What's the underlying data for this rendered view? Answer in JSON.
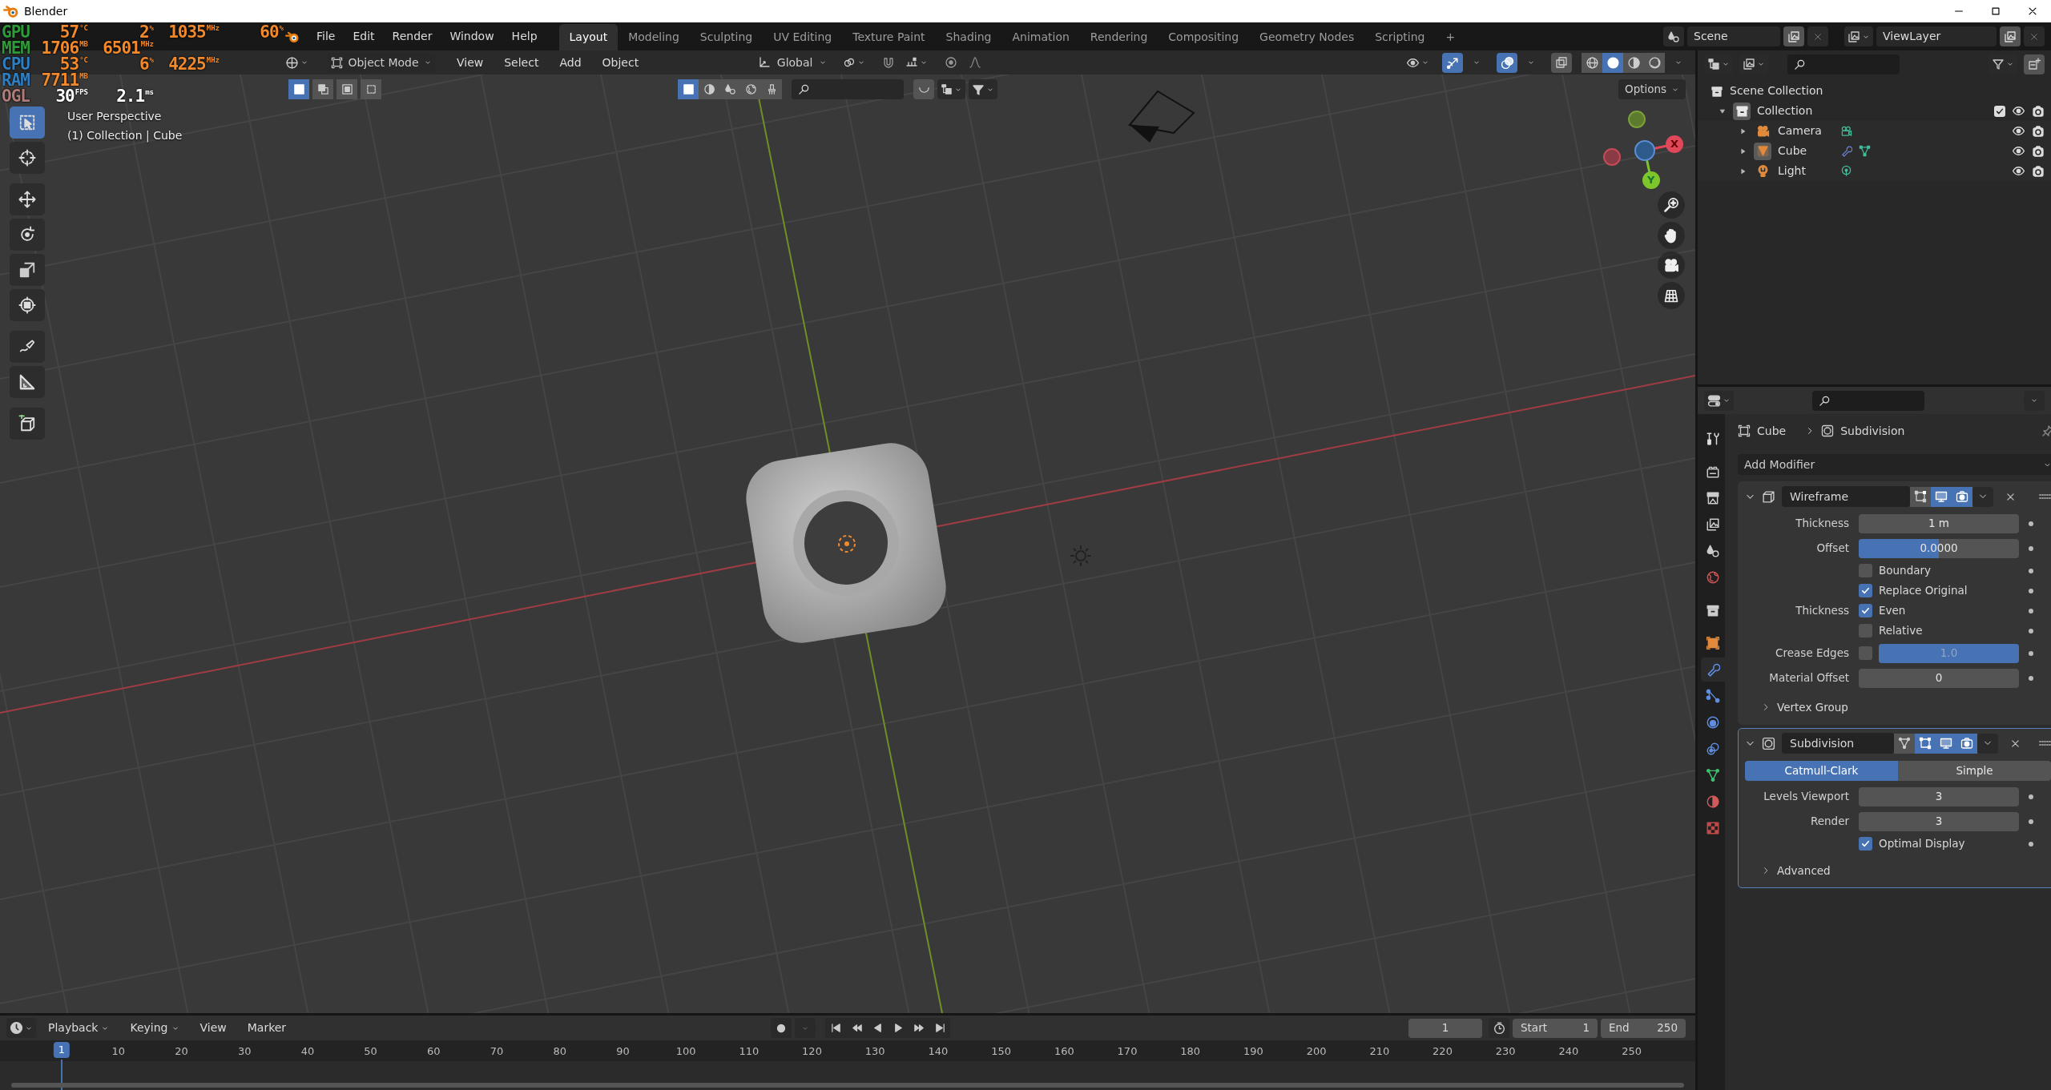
{
  "window": {
    "title": "Blender"
  },
  "menus": [
    "File",
    "Edit",
    "Render",
    "Window",
    "Help"
  ],
  "workspaces": [
    {
      "label": "Layout",
      "selected": true
    },
    {
      "label": "Modeling",
      "selected": false
    },
    {
      "label": "Sculpting",
      "selected": false
    },
    {
      "label": "UV Editing",
      "selected": false
    },
    {
      "label": "Texture Paint",
      "selected": false
    },
    {
      "label": "Shading",
      "selected": false
    },
    {
      "label": "Animation",
      "selected": false
    },
    {
      "label": "Rendering",
      "selected": false
    },
    {
      "label": "Compositing",
      "selected": false
    },
    {
      "label": "Geometry Nodes",
      "selected": false
    },
    {
      "label": "Scripting",
      "selected": false
    }
  ],
  "add_workspace": "+",
  "scene": "Scene",
  "view_layer": "ViewLayer",
  "hardware_monitor": [
    {
      "label": "GPU",
      "color": "#2f9a3a",
      "readings": [
        {
          "value": "57",
          "unit": "°C"
        },
        {
          "value": "2",
          "unit": "%"
        },
        {
          "value": "1035",
          "unit": "MHz"
        },
        {
          "value": "60",
          "unit": "%"
        }
      ]
    },
    {
      "label": "MEM",
      "color": "#2f9a3a",
      "readings": [
        {
          "value": "1706",
          "unit": "MB"
        },
        {
          "value": "6501",
          "unit": "MHz"
        }
      ]
    },
    {
      "label": "CPU",
      "color": "#2f7fc0",
      "readings": [
        {
          "value": "53",
          "unit": "°C"
        },
        {
          "value": "6",
          "unit": "%"
        },
        {
          "value": "4225",
          "unit": "MHz"
        }
      ]
    },
    {
      "label": "RAM",
      "color": "#2f7fc0",
      "readings": [
        {
          "value": "7711",
          "unit": "MB"
        }
      ]
    },
    {
      "label": "OGL",
      "color": "#b07c78",
      "readings": [
        {
          "value": "30",
          "unit": "FPS"
        },
        {
          "value": "2.1",
          "unit": "ms"
        }
      ]
    }
  ],
  "viewport": {
    "mode": "Object Mode",
    "menus": [
      "View",
      "Select",
      "Add",
      "Object"
    ],
    "orientation": "Global",
    "gizmos_on": true,
    "overlays_on": true,
    "xray_on": false,
    "shading": [
      {
        "kind": "wireframe",
        "selected": false
      },
      {
        "kind": "solid",
        "selected": true
      },
      {
        "kind": "material",
        "selected": false
      },
      {
        "kind": "rendered",
        "selected": false
      }
    ],
    "select_modes": [
      {
        "kind": "new",
        "selected": true
      },
      {
        "kind": "extend",
        "selected": false
      },
      {
        "kind": "subtract",
        "selected": false
      },
      {
        "kind": "intersect",
        "selected": false
      }
    ],
    "filters": [
      {
        "kind": "object",
        "selected": true
      },
      {
        "kind": "material",
        "selected": false
      },
      {
        "kind": "drops",
        "selected": false
      },
      {
        "kind": "world",
        "selected": false
      },
      {
        "kind": "brush",
        "selected": false
      }
    ],
    "options": "Options",
    "view_name": "User Perspective",
    "context": "(1) Collection | Cube",
    "tools": [
      {
        "kind": "select_box",
        "selected": true
      },
      {
        "kind": "cursor",
        "selected": false
      },
      {
        "kind": "move",
        "selected": false
      },
      {
        "kind": "rotate",
        "selected": false
      },
      {
        "kind": "scale",
        "selected": false
      },
      {
        "kind": "transform",
        "selected": false
      },
      {
        "kind": "annotate",
        "selected": false
      },
      {
        "kind": "measure",
        "selected": false
      },
      {
        "kind": "add_cube",
        "selected": false
      }
    ],
    "axis_labels": [
      "X",
      "Y"
    ]
  },
  "outliner": {
    "root": "Scene Collection",
    "items": [
      {
        "label": "Collection",
        "kind": "collection",
        "active": true,
        "expanded": true,
        "checked": true,
        "children": [
          {
            "label": "Camera",
            "kind": "camera",
            "active": false,
            "expanded": false
          },
          {
            "label": "Cube",
            "kind": "mesh",
            "active": true,
            "expanded": false
          },
          {
            "label": "Light",
            "kind": "light",
            "active": false,
            "expanded": false
          }
        ]
      }
    ]
  },
  "properties": {
    "tabs": [
      {
        "kind": "tool",
        "selected": false
      },
      {
        "kind": "render",
        "selected": false
      },
      {
        "kind": "output",
        "selected": false
      },
      {
        "kind": "view_layer",
        "selected": false
      },
      {
        "kind": "scene",
        "selected": false
      },
      {
        "kind": "world",
        "selected": false
      },
      {
        "kind": "collection",
        "selected": false
      },
      {
        "kind": "object",
        "selected": false
      },
      {
        "kind": "modifiers",
        "selected": true
      },
      {
        "kind": "particles",
        "selected": false
      },
      {
        "kind": "physics",
        "selected": false
      },
      {
        "kind": "constraints",
        "selected": false
      },
      {
        "kind": "data",
        "selected": false
      },
      {
        "kind": "material",
        "selected": false
      },
      {
        "kind": "texture",
        "selected": false
      }
    ],
    "breadcrumb": [
      "Cube",
      "Subdivision"
    ],
    "add_modifier": "Add Modifier",
    "modifiers": [
      {
        "kind": "wireframe",
        "name": "Wireframe",
        "active": false,
        "expanded": true,
        "toggles": [
          {
            "kind": "editmode",
            "on": false
          },
          {
            "kind": "realtime",
            "on": true
          },
          {
            "kind": "render",
            "on": true
          }
        ],
        "fields": [
          {
            "kind": "number",
            "label": "Thickness",
            "value": "1 m"
          },
          {
            "kind": "slider",
            "label": "Offset",
            "value": "0.0000",
            "level": 0.5
          },
          {
            "kind": "check",
            "text": "Boundary",
            "checked": false
          },
          {
            "kind": "check",
            "text": "Replace Original",
            "checked": true
          },
          {
            "kind": "check",
            "label": "Thickness",
            "text": "Even",
            "checked": true
          },
          {
            "kind": "check",
            "text": "Relative",
            "checked": false
          },
          {
            "kind": "check_slider",
            "label": "Crease Edges",
            "checked": false,
            "value": "1.0",
            "level": 1
          },
          {
            "kind": "number",
            "label": "Material Offset",
            "value": "0"
          }
        ],
        "subpanels": [
          {
            "label": "Vertex Group",
            "expanded": false
          }
        ]
      },
      {
        "kind": "subdivision",
        "name": "Subdivision",
        "active": true,
        "expanded": true,
        "toggles": [
          {
            "kind": "cage",
            "on": false
          },
          {
            "kind": "editmode",
            "on": true
          },
          {
            "kind": "realtime",
            "on": true
          },
          {
            "kind": "render",
            "on": true
          }
        ],
        "segments": [
          {
            "label": "Catmull-Clark",
            "selected": true
          },
          {
            "label": "Simple",
            "selected": false
          }
        ],
        "fields": [
          {
            "kind": "number",
            "label": "Levels Viewport",
            "value": "3"
          },
          {
            "kind": "number",
            "label": "Render",
            "value": "3"
          },
          {
            "kind": "check",
            "text": "Optimal Display",
            "checked": true
          }
        ],
        "subpanels": [
          {
            "label": "Advanced",
            "expanded": false
          }
        ]
      }
    ]
  },
  "timeline": {
    "menus": [
      {
        "label": "Playback",
        "dropdown": true
      },
      {
        "label": "Keying",
        "dropdown": true
      },
      {
        "label": "View",
        "dropdown": false
      },
      {
        "label": "Marker",
        "dropdown": false
      }
    ],
    "current_frame": "1",
    "start_label": "Start",
    "start": "1",
    "end_label": "End",
    "end": "250",
    "playhead": "1",
    "ticks": [
      "10",
      "20",
      "30",
      "40",
      "50",
      "60",
      "70",
      "80",
      "90",
      "100",
      "110",
      "120",
      "130",
      "140",
      "150",
      "160",
      "170",
      "180",
      "190",
      "200",
      "210",
      "220",
      "230",
      "240",
      "250"
    ]
  }
}
